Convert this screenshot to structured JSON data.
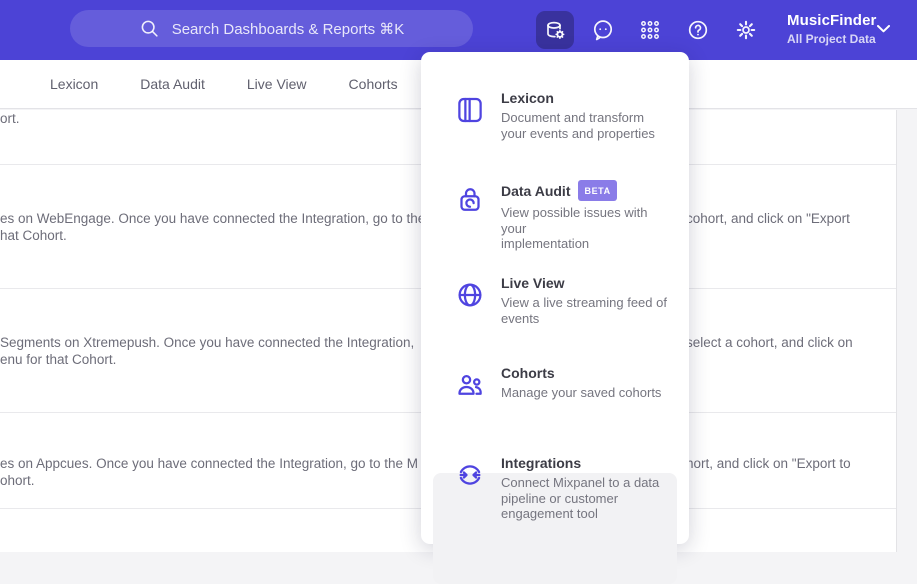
{
  "header": {
    "search_placeholder": "Search Dashboards & Reports ⌘K",
    "project_name": "MusicFinder",
    "project_subtitle": "All Project Data"
  },
  "tabs": {
    "items": [
      {
        "label": "Lexicon"
      },
      {
        "label": "Data Audit"
      },
      {
        "label": "Live View"
      },
      {
        "label": "Cohorts"
      }
    ]
  },
  "menu": {
    "items": [
      {
        "title": "Lexicon",
        "icon": "lexicon-book-icon",
        "desc": "Document and transform\nyour events and properties"
      },
      {
        "title": "Data Audit",
        "icon": "data-audit-icon",
        "badge": "BETA",
        "desc": "View possible issues with your\nimplementation"
      },
      {
        "title": "Live View",
        "icon": "live-view-globe-icon",
        "desc": "View a live streaming feed of\nevents"
      },
      {
        "title": "Cohorts",
        "icon": "cohorts-people-icon",
        "desc": "Manage your saved cohorts"
      },
      {
        "title": "Integrations",
        "icon": "integrations-sync-icon",
        "desc": "Connect Mixpanel to a data\npipeline or customer\nengagement tool",
        "highlighted": true
      }
    ]
  },
  "content": {
    "rows": [
      {
        "line1_left": "ort.",
        "line1_right": "",
        "line2_left": ""
      },
      {
        "line1_left": "es on WebEngage. Once you have connected the Integration, go to the",
        "line1_right": "cohort, and click on \"Export",
        "line2_left": "hat Cohort."
      },
      {
        "line1_left": "Segments on Xtremepush. Once you have connected the Integration, ",
        "line1_right": "select a cohort, and click on",
        "line2_left": "enu for that Cohort."
      },
      {
        "line1_left": "es on Appcues. Once you have connected the Integration, go to the M",
        "line1_right": "hort, and click on \"Export to",
        "line2_left": "ohort."
      }
    ]
  },
  "colors": {
    "header_bg": "#4c43d6",
    "active_icon_bg": "#39329e",
    "accent": "#4f44e0",
    "badge_bg": "#8a7ce8",
    "highlight_bg": "#f2f2f4"
  }
}
